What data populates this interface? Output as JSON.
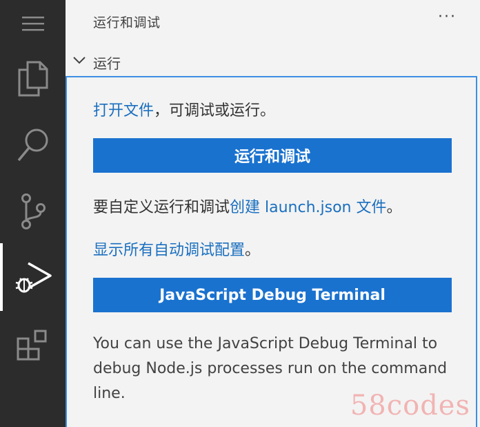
{
  "activity_bar": {
    "items": [
      {
        "icon": "menu-icon"
      },
      {
        "icon": "explorer-files-icon"
      },
      {
        "icon": "search-icon"
      },
      {
        "icon": "source-control-icon"
      },
      {
        "icon": "run-debug-icon",
        "active": true
      },
      {
        "icon": "extensions-icon"
      }
    ]
  },
  "panel": {
    "title": "运行和调试",
    "more_label": "···",
    "section": {
      "label": "运行",
      "expanded": true
    },
    "open_file_link": "打开文件",
    "open_file_rest": "，可调试或运行。",
    "run_debug_button": "运行和调试",
    "customize_text": "要自定义运行和调试",
    "create_launch_link": "创建 launch.json 文件",
    "customize_end": "。",
    "show_all_link": "显示所有自动调试配置",
    "show_all_end": "。",
    "js_debug_button": "JavaScript Debug Terminal",
    "description": "You can use the JavaScript Debug Terminal to debug Node.js processes run on the command line."
  },
  "watermark": "58codes",
  "colors": {
    "activity_bg": "#2c2c2c",
    "panel_bg": "#f3f3f3",
    "button_bg": "#1a72cf",
    "link": "#1a6fbf",
    "focus_border": "#3c8ee3"
  }
}
